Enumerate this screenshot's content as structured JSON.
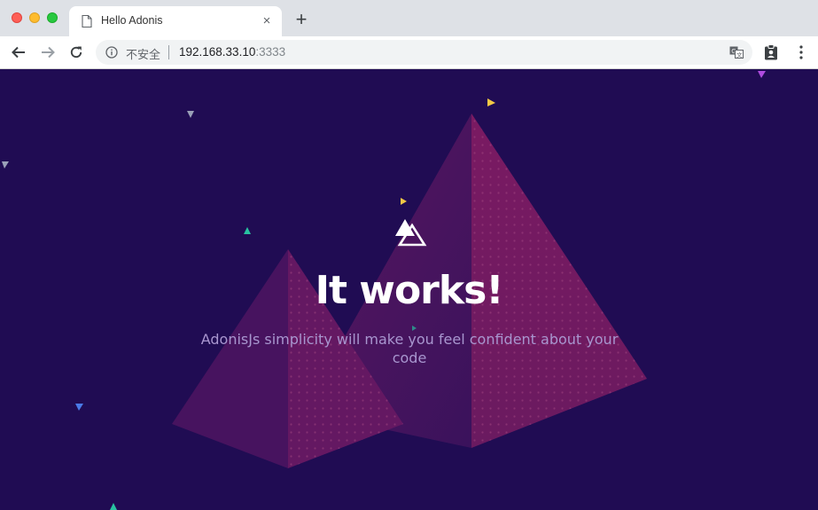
{
  "tab": {
    "title": "Hello Adonis",
    "close_glyph": "×"
  },
  "newtab_glyph": "+",
  "omnibox": {
    "security_label": "不安全",
    "url_host": "192.168.33.10",
    "url_port": ":3333"
  },
  "icons": {
    "back": "back-arrow-icon",
    "forward": "forward-arrow-icon",
    "reload": "reload-icon",
    "info": "info-icon",
    "translate": "translate-icon",
    "extension": "clipboard-extension-icon",
    "menu": "more-vert-icon",
    "tab": "document-icon",
    "logo": "adonis-logo-icon"
  },
  "page": {
    "headline": "It works!",
    "subtext": "AdonisJs simplicity will make you feel confident about your code",
    "background_color": "#200c53"
  }
}
